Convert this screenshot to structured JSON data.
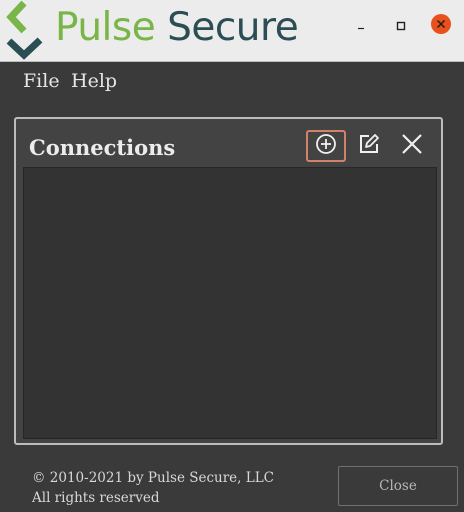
{
  "app": {
    "brand_part1": "Pulse",
    "brand_part2": "Secure"
  },
  "menu": {
    "file": "File",
    "help": "Help"
  },
  "connections": {
    "title": "Connections",
    "items": []
  },
  "footer": {
    "copyright": "© 2010-2021 by Pulse Secure, LLC",
    "rights": "All rights reserved",
    "close_label": "Close"
  },
  "icons": {
    "minimize": "minimize-icon",
    "maximize": "maximize-icon",
    "close_window": "close-icon",
    "add": "add-circle-icon",
    "edit": "edit-icon",
    "delete": "delete-x-icon"
  },
  "colors": {
    "brand_green": "#7ab547",
    "brand_teal": "#2b4e55",
    "window_close": "#e8501e",
    "active_outline": "#d2826a"
  }
}
